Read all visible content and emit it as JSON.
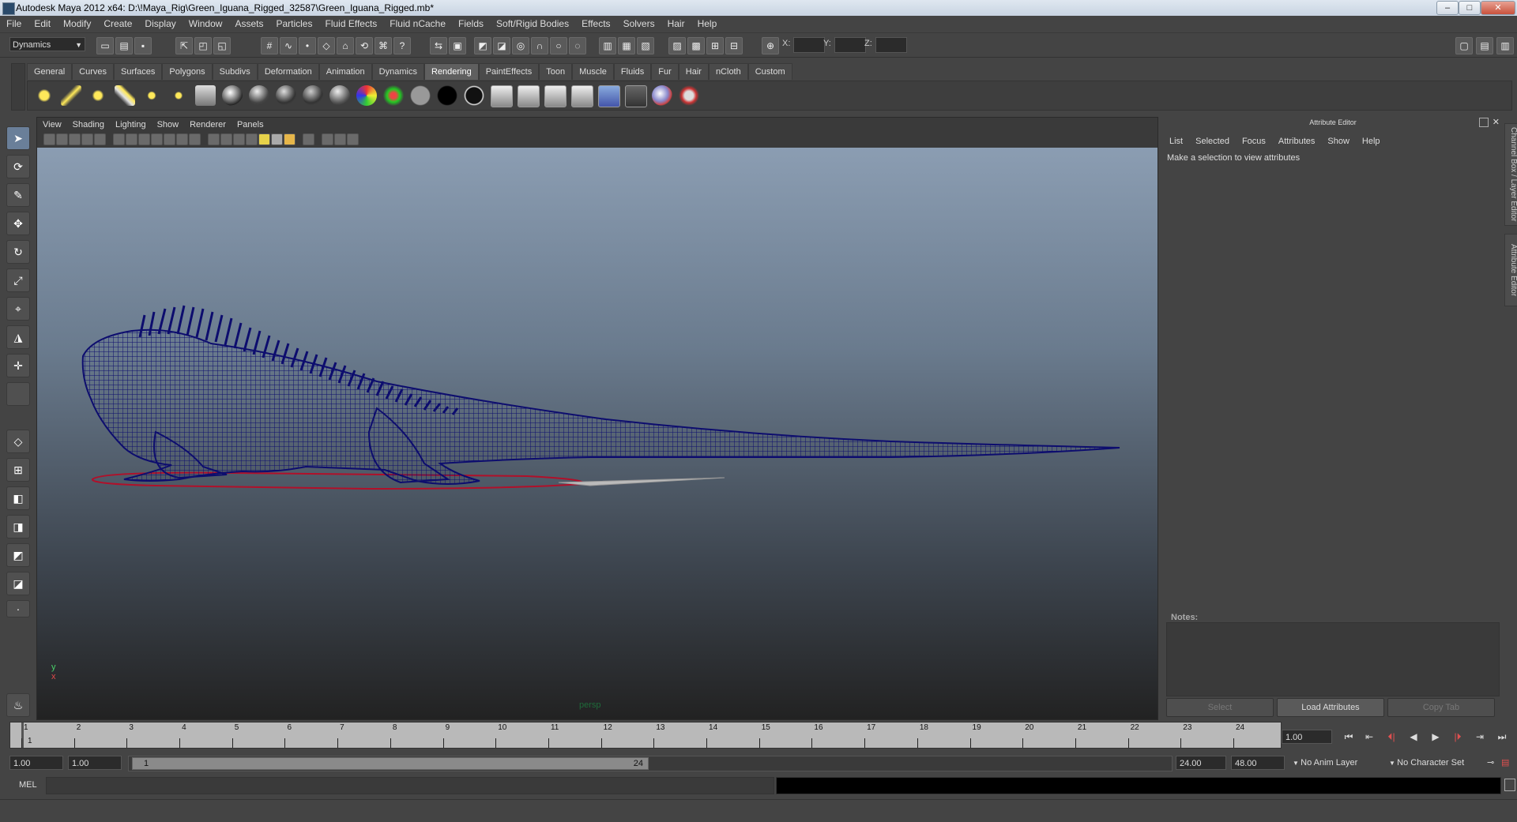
{
  "window": {
    "title": "Autodesk Maya 2012 x64: D:\\!Maya_Rig\\Green_Iguana_Rigged_32587\\Green_Iguana_Rigged.mb*",
    "controls": [
      "–",
      "□",
      "✕"
    ]
  },
  "menubar": [
    "File",
    "Edit",
    "Modify",
    "Create",
    "Display",
    "Window",
    "Assets",
    "Particles",
    "Fluid Effects",
    "Fluid nCache",
    "Fields",
    "Soft/Rigid Bodies",
    "Effects",
    "Solvers",
    "Hair",
    "Help"
  ],
  "statusline": {
    "mode": "Dynamics",
    "coord_labels": {
      "x": "X:",
      "y": "Y:",
      "z": "Z:"
    }
  },
  "shelf": {
    "tabs": [
      "General",
      "Curves",
      "Surfaces",
      "Polygons",
      "Subdivs",
      "Deformation",
      "Animation",
      "Dynamics",
      "Rendering",
      "PaintEffects",
      "Toon",
      "Muscle",
      "Fluids",
      "Fur",
      "Hair",
      "nCloth",
      "Custom"
    ],
    "active_tab": "Rendering",
    "icons": [
      "ambient-light-icon",
      "directional-light-icon",
      "point-light-icon",
      "spot-light-icon",
      "area-light-icon",
      "volume-light-icon",
      "camera-icon",
      "lambert-icon",
      "blinn-icon",
      "phong-icon",
      "phong-e-icon",
      "anisotropic-icon",
      "layered-shader-icon",
      "ramp-shader-icon",
      "surface-shader-icon",
      "use-background-icon",
      "black-shader-icon",
      "hypershade-icon",
      "render-view-icon",
      "render-settings-icon",
      "ipr-icon",
      "batch-render-icon",
      "render-layer-icon",
      "mental-ray-icon",
      "paint-icon"
    ]
  },
  "viewport": {
    "menu": [
      "View",
      "Shading",
      "Lighting",
      "Show",
      "Renderer",
      "Panels"
    ],
    "camera_label": "persp",
    "axis": {
      "y": "y",
      "x": "x"
    },
    "colors": {
      "wireframe": "#0d0d6e",
      "base": "#b0102a"
    }
  },
  "attribute_editor": {
    "header": "Attribute Editor",
    "menu": [
      "List",
      "Selected",
      "Focus",
      "Attributes",
      "Show",
      "Help"
    ],
    "message": "Make a selection to view attributes",
    "notes_label": "Notes:",
    "buttons": {
      "select": "Select",
      "load": "Load Attributes",
      "copy": "Copy Tab"
    },
    "side_tabs": [
      "Channel Box / Layer Editor",
      "Attribute Editor"
    ]
  },
  "timeslider": {
    "ticks": [
      "1",
      "2",
      "3",
      "4",
      "5",
      "6",
      "7",
      "8",
      "9",
      "10",
      "11",
      "12",
      "13",
      "14",
      "15",
      "16",
      "17",
      "18",
      "19",
      "20",
      "21",
      "22",
      "23",
      "24"
    ],
    "current_label": "1",
    "current_frame": "1.00"
  },
  "playback": [
    "⏮",
    "⇤",
    "⏴|",
    "◀",
    "▶",
    "|⏵",
    "⇥",
    "⏭"
  ],
  "range": {
    "start": "1.00",
    "playback_start": "1.00",
    "handle_start": "1",
    "handle_end": "24",
    "playback_end": "24.00",
    "end": "48.00",
    "anim_layer": "No Anim Layer",
    "character_set": "No Character Set"
  },
  "cmdline": {
    "label": "MEL"
  }
}
